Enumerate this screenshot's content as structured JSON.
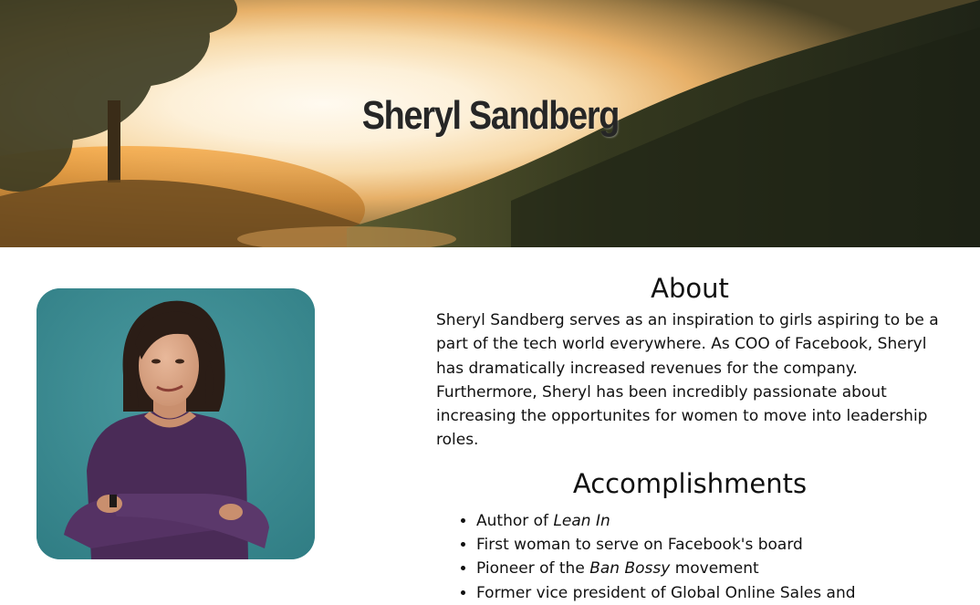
{
  "hero": {
    "title": "Sheryl Sandberg",
    "background_image": "sunset-hillside-path",
    "sun_color": "#fff3dc",
    "glow_color": "#f3a13a",
    "shadow_color": "#272a1a"
  },
  "portrait": {
    "alt": "Sheryl Sandberg portrait",
    "backdrop_color": "#3f8d93",
    "dress_color": "#4a2b57"
  },
  "about": {
    "heading": "About",
    "text": "Sheryl Sandberg serves as an inspiration to girls aspiring to be a part of the tech world everywhere. As COO of Facebook, Sheryl has dramatically increased revenues for the company. Furthermore, Sheryl has been incredibly passionate about increasing the opportunites for women to move into leadership roles."
  },
  "accomplishments": {
    "heading": "Accomplishments",
    "items": [
      {
        "before": "Author of ",
        "emphasis": "Lean In",
        "after": ""
      },
      {
        "before": "First woman to serve on Facebook's board",
        "emphasis": "",
        "after": ""
      },
      {
        "before": "Pioneer of the ",
        "emphasis": "Ban Bossy",
        "after": " movement"
      },
      {
        "before": "Former vice president of Global Online Sales and",
        "emphasis": "",
        "after": ""
      }
    ]
  }
}
